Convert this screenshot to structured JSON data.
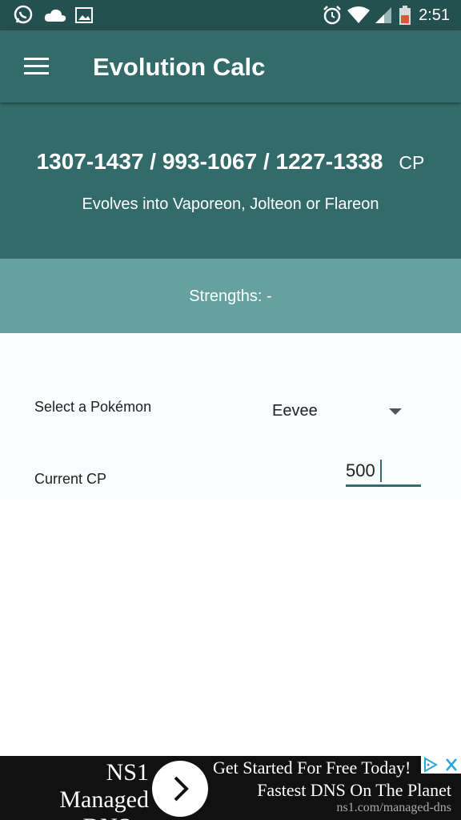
{
  "status_bar": {
    "time": "2:51",
    "left_icons": [
      "whatsapp-icon",
      "cloud-icon",
      "image-icon"
    ],
    "right_icons": [
      "alarm-icon",
      "wifi-icon",
      "signal-icon",
      "battery-icon"
    ]
  },
  "app_bar": {
    "title": "Evolution Calc",
    "menu_icon": "hamburger-menu-icon"
  },
  "header": {
    "cp_ranges": "1307-1437 / 993-1067 / 1227-1338",
    "cp_unit": "CP",
    "evolves_text": "Evolves into Vaporeon, Jolteon or Flareon"
  },
  "strengths": {
    "text": "Strengths: -"
  },
  "form": {
    "pokemon_label": "Select a Pokémon",
    "pokemon_value": "Eevee",
    "cp_label": "Current CP",
    "cp_value": "500"
  },
  "ad": {
    "left_text_line1": "NS1 Managed",
    "left_text_line2": "DNS »",
    "headline": "Get Started For Free Today!",
    "subline": "Fastest DNS On The Planet",
    "url": "ns1.com/managed-dns"
  },
  "colors": {
    "primary": "#326b69",
    "primary_dark": "#24504f",
    "accent_light": "#66a09f"
  }
}
